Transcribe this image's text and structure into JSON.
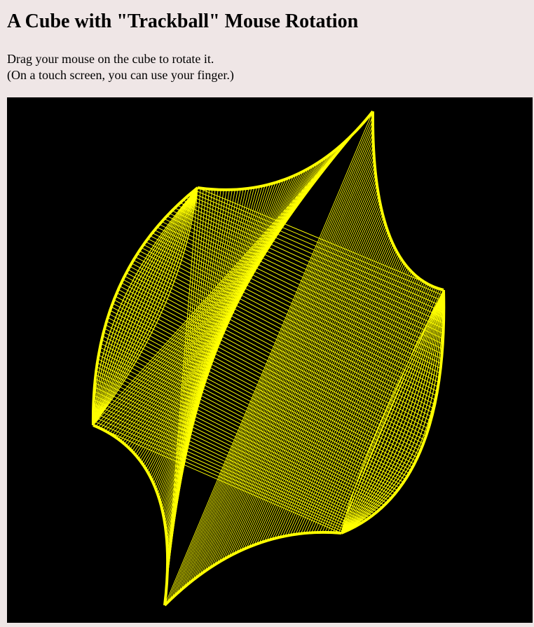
{
  "page": {
    "title": "A Cube with \"Trackball\" Mouse Rotation",
    "instruction_line_1": "Drag your mouse on the cube to rotate it.",
    "instruction_line_2": "(On a touch screen, you can use your finger.)"
  },
  "canvas": {
    "background_color": "#000000",
    "stroke_color": "#ffff00"
  }
}
